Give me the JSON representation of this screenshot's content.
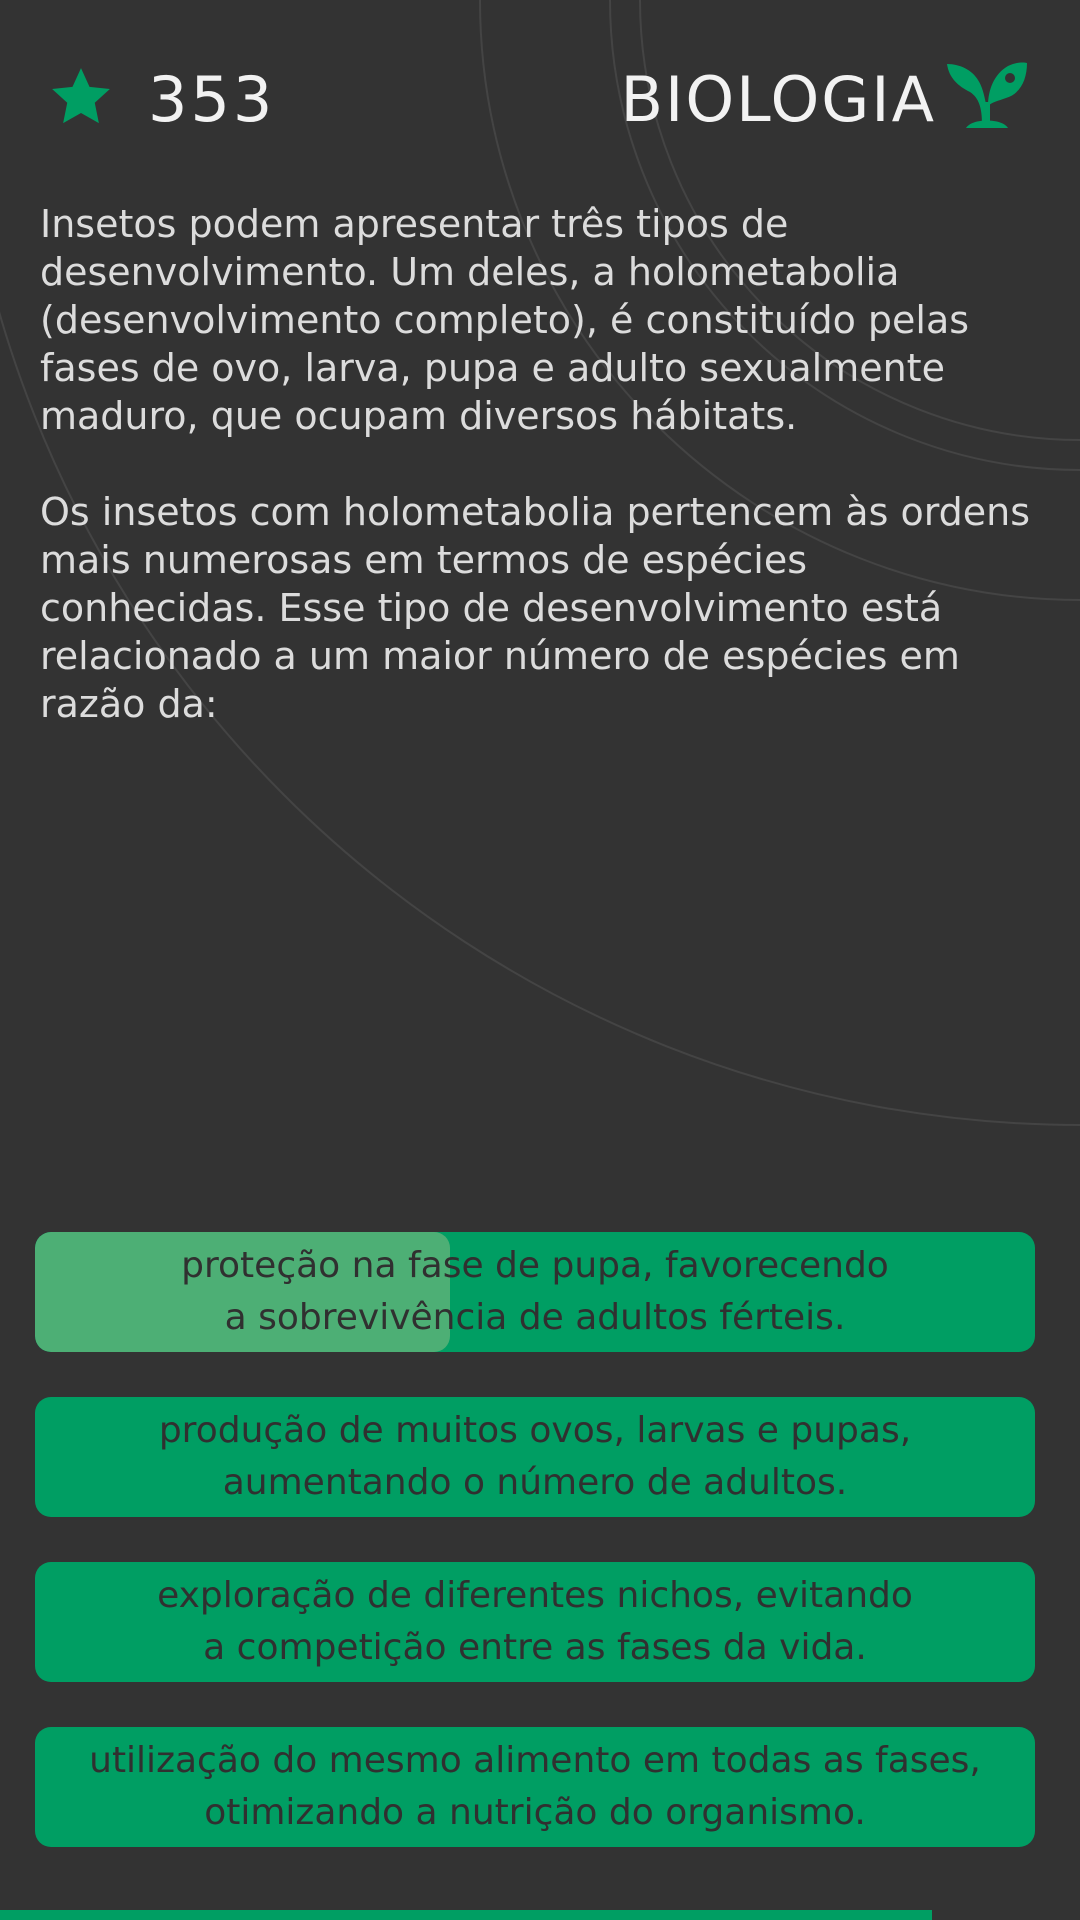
{
  "header": {
    "score": "353",
    "subject": "BIOLOGIA",
    "star_icon": "star-icon",
    "subject_icon": "sprout-icon"
  },
  "question": {
    "paragraph_1": "Insetos podem apresentar três tipos de desenvolvimento. Um deles, a holometabolia (desenvolvimento completo), é constituído pelas fases de ovo, larva, pupa e adulto sexualmente maduro, que ocupam diversos hábitats.",
    "paragraph_2": "Os insetos com holometabolia pertencem às ordens mais numerosas em termos de espécies conhecidas. Esse tipo de desenvolvimento está relacionado a um maior número de espécies em razão da:"
  },
  "answers": [
    {
      "text": "proteção na fase de pupa, favorecendo\na sobrevivência de adultos férteis.",
      "highlight_fraction": 0.415
    },
    {
      "text": "produção de muitos ovos, larvas e pupas,\naumentando o número de adultos."
    },
    {
      "text": "exploração de diferentes nichos, evitando\na competição entre as fases da vida."
    },
    {
      "text": "utilização do mesmo alimento em todas as fases,\notimizando a nutrição do organismo."
    }
  ],
  "colors": {
    "background": "#333333",
    "accent": "#009e63",
    "highlight": "#4daf75",
    "text_light": "#dcdcdc",
    "text_dark": "#303030"
  },
  "progress": 0.863
}
